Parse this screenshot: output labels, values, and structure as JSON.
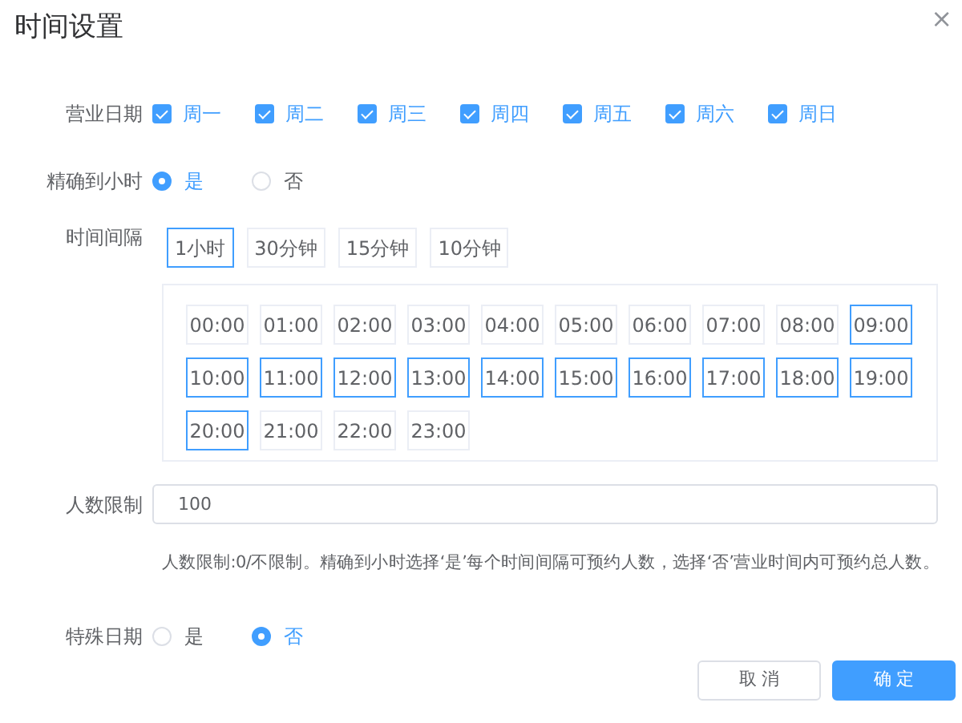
{
  "dialog": {
    "title": "时间设置",
    "close": "×"
  },
  "business_days": {
    "label": "营业日期",
    "days": [
      {
        "label": "周一",
        "checked": true
      },
      {
        "label": "周二",
        "checked": true
      },
      {
        "label": "周三",
        "checked": true
      },
      {
        "label": "周四",
        "checked": true
      },
      {
        "label": "周五",
        "checked": true
      },
      {
        "label": "周六",
        "checked": true
      },
      {
        "label": "周日",
        "checked": true
      }
    ]
  },
  "hourly": {
    "label": "精确到小时",
    "options": [
      {
        "label": "是",
        "selected": true
      },
      {
        "label": "否",
        "selected": false
      }
    ]
  },
  "interval": {
    "label": "时间间隔",
    "options": [
      {
        "label": "1小时",
        "selected": true
      },
      {
        "label": "30分钟",
        "selected": false
      },
      {
        "label": "15分钟",
        "selected": false
      },
      {
        "label": "10分钟",
        "selected": false
      }
    ]
  },
  "slots": [
    {
      "label": "00:00",
      "selected": false
    },
    {
      "label": "01:00",
      "selected": false
    },
    {
      "label": "02:00",
      "selected": false
    },
    {
      "label": "03:00",
      "selected": false
    },
    {
      "label": "04:00",
      "selected": false
    },
    {
      "label": "05:00",
      "selected": false
    },
    {
      "label": "06:00",
      "selected": false
    },
    {
      "label": "07:00",
      "selected": false
    },
    {
      "label": "08:00",
      "selected": false
    },
    {
      "label": "09:00",
      "selected": true
    },
    {
      "label": "10:00",
      "selected": true
    },
    {
      "label": "11:00",
      "selected": true
    },
    {
      "label": "12:00",
      "selected": true
    },
    {
      "label": "13:00",
      "selected": true
    },
    {
      "label": "14:00",
      "selected": true
    },
    {
      "label": "15:00",
      "selected": true
    },
    {
      "label": "16:00",
      "selected": true
    },
    {
      "label": "17:00",
      "selected": true
    },
    {
      "label": "18:00",
      "selected": true
    },
    {
      "label": "19:00",
      "selected": true
    },
    {
      "label": "20:00",
      "selected": true
    },
    {
      "label": "21:00",
      "selected": false
    },
    {
      "label": "22:00",
      "selected": false
    },
    {
      "label": "23:00",
      "selected": false
    }
  ],
  "limit": {
    "label": "人数限制",
    "value": "100",
    "hint": "人数限制:0/不限制。精确到小时选择‘是’每个时间间隔可预约人数，选择‘否’营业时间内可预约总人数。"
  },
  "special_date": {
    "label": "特殊日期",
    "options": [
      {
        "label": "是",
        "selected": false
      },
      {
        "label": "否",
        "selected": true
      }
    ]
  },
  "buttons": [
    {
      "label": "取 消",
      "kind": "secondary"
    },
    {
      "label": "确 定",
      "kind": "primary"
    }
  ]
}
